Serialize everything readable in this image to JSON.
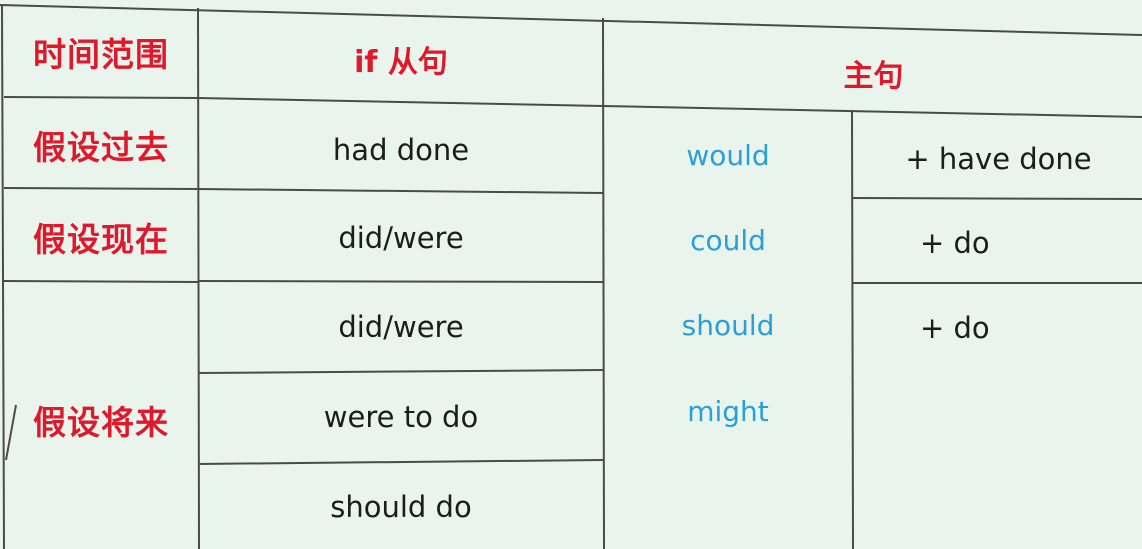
{
  "header": {
    "time_range": "时间范围",
    "if_clause": "if 从句",
    "main_clause": "主句"
  },
  "rows": {
    "past": {
      "label": "假设过去",
      "if_form": "had done",
      "main_suffix": "+ have done"
    },
    "present": {
      "label": "假设现在",
      "if_form": "did/were",
      "main_suffix": "+ do"
    },
    "future": {
      "label": "假设将来",
      "if_forms": [
        "did/were",
        "were to do",
        "should do"
      ],
      "main_suffix": "+ do"
    }
  },
  "modals": [
    "would",
    "could",
    "should",
    "might"
  ],
  "colors": {
    "label_red": "#e0182c",
    "modal_blue": "#2a9fd8",
    "line": "#4a4a4a",
    "background": "#e9f5ec"
  }
}
